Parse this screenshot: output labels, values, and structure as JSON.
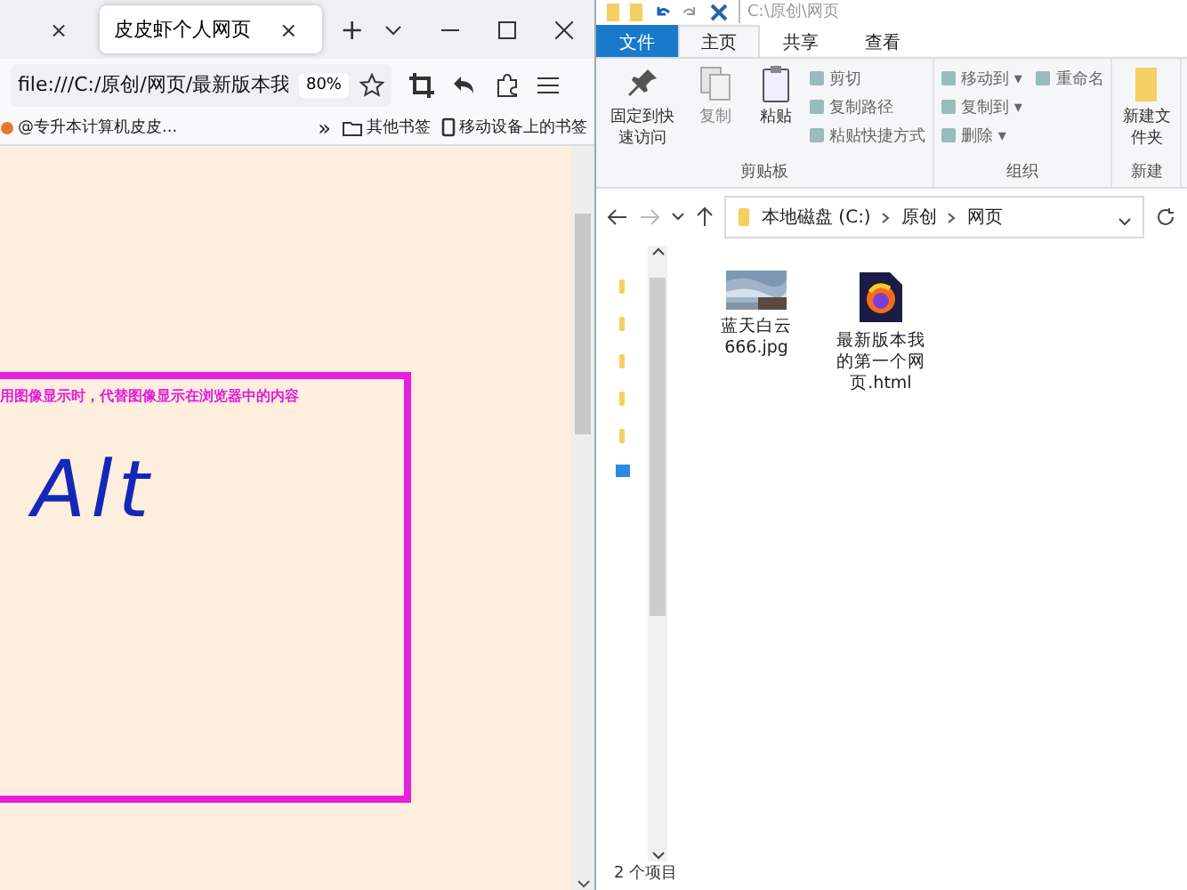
{
  "browser": {
    "tabs": [
      {
        "close": "×",
        "selected": false
      },
      {
        "label": "皮皮虾个人网页",
        "close": "×",
        "selected": true
      }
    ],
    "new_tab": "+",
    "url": "file:///C:/原创/网页/最新版本我",
    "zoom": "80%",
    "bookmarks": [
      {
        "kind": "site",
        "label": "@专升本计算机皮皮..."
      },
      {
        "kind": "more",
        "label": "»"
      },
      {
        "kind": "folder",
        "label": "其他书签"
      },
      {
        "kind": "mobile",
        "label": "移动设备上的书签"
      }
    ],
    "page": {
      "alt_text": "用图像显示时，代替图像显示在浏览器中的内容",
      "handwriting": "Alt"
    }
  },
  "explorer": {
    "path_title": "C:\\原创\\网页",
    "ribbon_tabs": [
      {
        "label": "文件",
        "kind": "file",
        "selected": false
      },
      {
        "label": "主页",
        "kind": "tab",
        "selected": true
      },
      {
        "label": "共享",
        "kind": "tab",
        "selected": false
      },
      {
        "label": "查看",
        "kind": "tab",
        "selected": false
      }
    ],
    "groups": [
      {
        "label": "剪贴板",
        "big": [
          {
            "label": "固定到快速访问",
            "kind": "pin"
          },
          {
            "label": "复制",
            "kind": "copy"
          },
          {
            "label": "粘贴",
            "kind": "paste"
          }
        ],
        "small": [
          "剪切",
          "复制路径",
          "粘贴快捷方式"
        ]
      },
      {
        "label": "组织",
        "small": [
          "移动到 ▾",
          "复制到 ▾",
          "删除 ▾",
          "重命名"
        ]
      },
      {
        "label": "新建",
        "big": [
          {
            "label": "新建文件夹",
            "kind": "folder"
          }
        ]
      }
    ],
    "breadcrumb": [
      "本地磁盘 (C:)",
      "原创",
      "网页"
    ],
    "files": [
      {
        "name": "蓝天白云666.jpg"
      },
      {
        "kind": "html",
        "name": "最新版本我的第一个网页.html"
      }
    ],
    "status": "2 个项目"
  }
}
